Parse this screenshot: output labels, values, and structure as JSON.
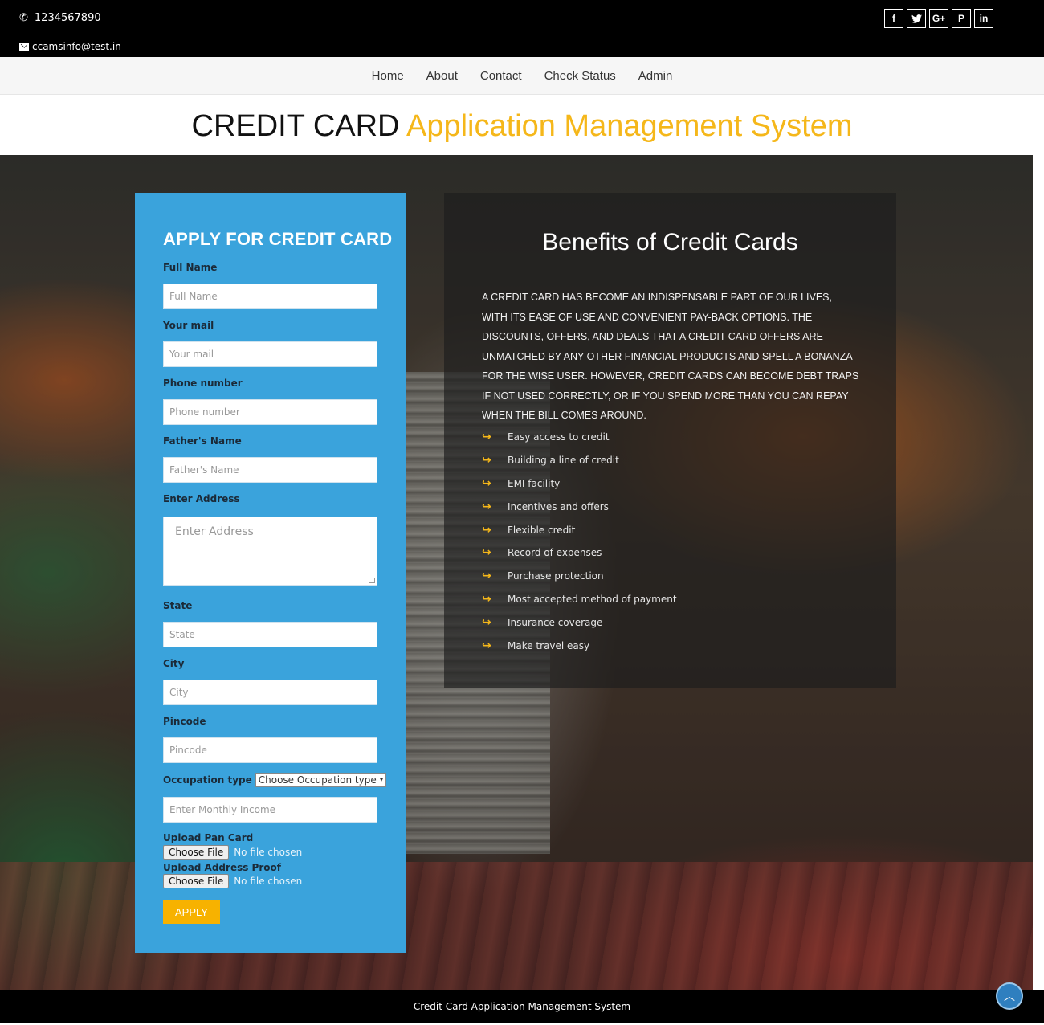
{
  "topbar": {
    "phone": "1234567890",
    "email": "ccamsinfo@test.in",
    "social": [
      {
        "icon": "facebook-icon",
        "glyph": "f"
      },
      {
        "icon": "twitter-icon",
        "glyph": "🐦"
      },
      {
        "icon": "google-plus-icon",
        "glyph": "G+"
      },
      {
        "icon": "pinterest-icon",
        "glyph": "P"
      },
      {
        "icon": "linkedin-icon",
        "glyph": "in"
      }
    ]
  },
  "nav": {
    "home": "Home",
    "about": "About",
    "contact": "Contact",
    "check_status": "Check Status",
    "admin": "Admin"
  },
  "header": {
    "title_part1": "CREDIT CARD",
    "title_part2": "Application Management System"
  },
  "form": {
    "title": "APPLY FOR CREDIT CARD",
    "full_name_label": "Full Name",
    "full_name_placeholder": "Full Name",
    "mail_label": "Your mail",
    "mail_placeholder": "Your mail",
    "phone_label": "Phone number",
    "phone_placeholder": "Phone number",
    "father_label": "Father's Name",
    "father_placeholder": "Father's Name",
    "address_label": "Enter Address",
    "address_placeholder": "Enter Address",
    "state_label": "State",
    "state_placeholder": "State",
    "city_label": "City",
    "city_placeholder": "City",
    "pincode_label": "Pincode",
    "pincode_placeholder": "Pincode",
    "occupation_label": "Occupation type",
    "occupation_selected": "Choose Occupation type",
    "income_placeholder": "Enter Monthly Income",
    "pan_label": "Upload Pan Card",
    "address_proof_label": "Upload Address Proof",
    "choose_file": "Choose File",
    "no_file": "No file chosen",
    "apply": "APPLY"
  },
  "benefits": {
    "title": "Benefits of Credit Cards",
    "paragraph": "A credit card has become an indispensable part of our lives, with its ease of use and convenient pay-back options. The discounts, offers, and deals that a credit card offers are unmatched by any other financial products and spell a bonanza for the wise user. However, credit cards can become debt traps if not used correctly, or if you spend more than you can repay when the bill comes around.",
    "items": [
      "Easy access to credit",
      "Building a line of credit",
      "EMI facility",
      "Incentives and offers",
      "Flexible credit",
      "Record of expenses",
      "Purchase protection",
      "Most accepted method of payment",
      "Insurance coverage",
      "Make travel easy"
    ]
  },
  "footer": {
    "text": "Credit Card Application Management System"
  },
  "colors": {
    "accent": "#f5b71a",
    "form_bg": "#3aa3dc",
    "apply_btn": "#f7b200"
  }
}
